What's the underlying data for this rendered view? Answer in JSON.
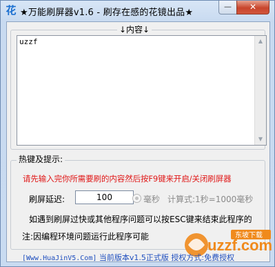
{
  "window": {
    "app_icon_glyph": "花",
    "title": "★万能刷屏器v1.6 - 刷存在感的花镜出品★",
    "minimize_glyph": "—",
    "close_glyph": "✕"
  },
  "content_group": {
    "legend": "↓内容↓",
    "text_value": "uzzf"
  },
  "hotkey_group": {
    "legend": "热键及提示:",
    "instruction": "请先输入完你所需要刷的内容然后按F9键来开启/关闭刷屏器",
    "delay_label": "刷屏延迟:",
    "delay_value": "100",
    "unit_label": "毫秒",
    "calc_label": "计算式:1秒=1000毫秒",
    "hint_line1": "如遇到刷屏过快或其他程序问题可以按ESC键来结束此程序的",
    "hint_line2": "注:因编程环境问题运行此程序可能"
  },
  "footer": {
    "site": "[Www.HuaJinV5.Com]",
    "version": "当前版本v1.5正式版 授权方式:免费授权"
  },
  "watermark": {
    "text": "uzzf.com",
    "tagline": "东坡下载"
  },
  "colors": {
    "instruction": "#e01818",
    "footer": "#1f4fbf",
    "watermark_orange": "#f08a1c"
  }
}
